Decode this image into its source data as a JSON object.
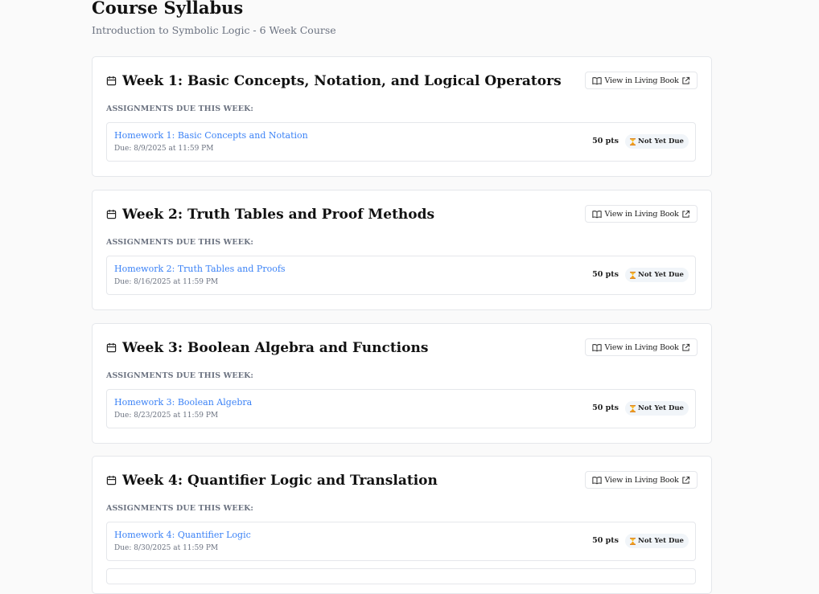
{
  "page": {
    "title": "Course Syllabus",
    "subtitle": "Introduction to Symbolic Logic - 6 Week Course"
  },
  "weeks": [
    {
      "title": "Week 1: Basic Concepts, Notation, and Logical Operators",
      "view_button": "View in Living Book",
      "assignments_heading": "ASSIGNMENTS DUE THIS WEEK:",
      "assignment": {
        "name": "Homework 1: Basic Concepts and Notation",
        "due": "Due: 8/9/2025 at 11:59 PM",
        "points": "50 pts",
        "status": "Not Yet Due"
      }
    },
    {
      "title": "Week 2: Truth Tables and Proof Methods",
      "view_button": "View in Living Book",
      "assignments_heading": "ASSIGNMENTS DUE THIS WEEK:",
      "assignment": {
        "name": "Homework 2: Truth Tables and Proofs",
        "due": "Due: 8/16/2025 at 11:59 PM",
        "points": "50 pts",
        "status": "Not Yet Due"
      }
    },
    {
      "title": "Week 3: Boolean Algebra and Functions",
      "view_button": "View in Living Book",
      "assignments_heading": "ASSIGNMENTS DUE THIS WEEK:",
      "assignment": {
        "name": "Homework 3: Boolean Algebra",
        "due": "Due: 8/23/2025 at 11:59 PM",
        "points": "50 pts",
        "status": "Not Yet Due"
      }
    },
    {
      "title": "Week 4: Quantifier Logic and Translation",
      "view_button": "View in Living Book",
      "assignments_heading": "ASSIGNMENTS DUE THIS WEEK:",
      "assignment": {
        "name": "Homework 4: Quantifier Logic",
        "due": "Due: 8/30/2025 at 11:59 PM",
        "points": "50 pts",
        "status": "Not Yet Due"
      }
    }
  ],
  "colors": {
    "link": "#3b82f6",
    "muted": "#6b7280",
    "badge_bg": "#f1f5f9",
    "badge_icon": "#f59e0b"
  },
  "icons": {
    "week": "calendar-icon",
    "view": "book-open-icon",
    "external": "external-link-icon",
    "status": "hourglass-icon"
  }
}
